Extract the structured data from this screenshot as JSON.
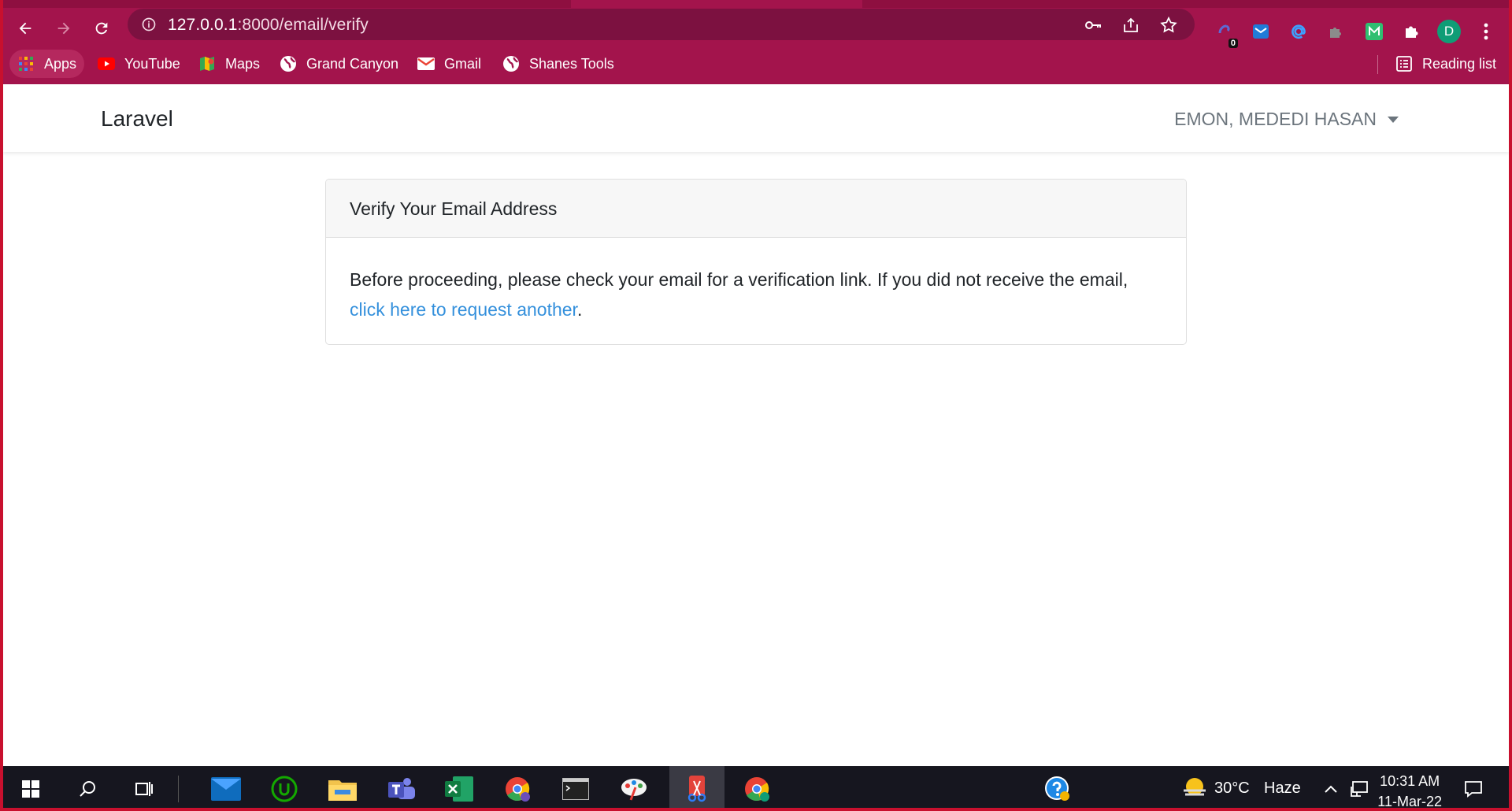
{
  "browser": {
    "url_host": "127.0.0.1",
    "url_path": ":8000/email/verify",
    "bookmarks": [
      {
        "label": "Apps",
        "icon": "apps-grid-icon"
      },
      {
        "label": "YouTube",
        "icon": "youtube-icon"
      },
      {
        "label": "Maps",
        "icon": "maps-icon"
      },
      {
        "label": "Grand Canyon",
        "icon": "globe-icon"
      },
      {
        "label": "Gmail",
        "icon": "gmail-icon"
      },
      {
        "label": "Shanes Tools",
        "icon": "globe-icon"
      }
    ],
    "reading_list": "Reading list",
    "extension_badge": "0",
    "profile_initial": "D",
    "accent_color": "#a3144c"
  },
  "app": {
    "brand": "Laravel",
    "user_name": "EMON, MEDEDI HASAN"
  },
  "card": {
    "title": "Verify Your Email Address",
    "body_text": "Before proceeding, please check your email for a verification link. If you did not receive the email, ",
    "link_text": "click here to request another",
    "trailing": "."
  },
  "taskbar": {
    "weather_temp": "30°C",
    "weather_desc": "Haze",
    "time": "10:31 AM",
    "date": "11-Mar-22"
  }
}
